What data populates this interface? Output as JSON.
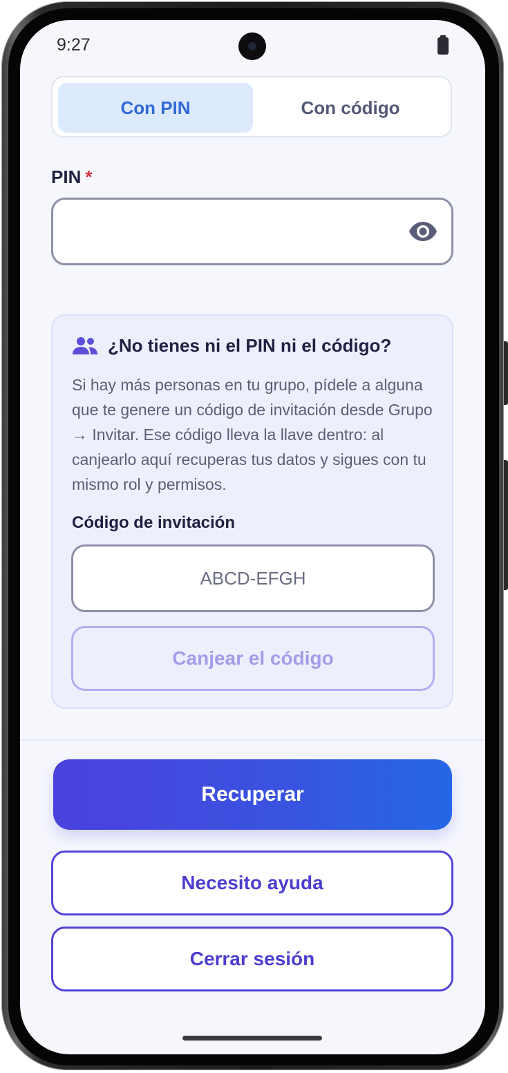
{
  "status_bar": {
    "time": "9:27",
    "icons": [
      "front-camera",
      "battery-icon"
    ]
  },
  "tabs": [
    {
      "label": "Con PIN",
      "selected": true
    },
    {
      "label": "Con código",
      "selected": false
    }
  ],
  "pin_field": {
    "label": "PIN",
    "required_marker": "*",
    "value": "",
    "icon": "eye-icon"
  },
  "help_card": {
    "icon": "people-icon",
    "title": "¿No tienes ni el PIN ni el código?",
    "body": "Si hay más personas en tu grupo, pídele a alguna que te genere un código de invitación desde Grupo → Invitar. Ese código lleva la llave dentro: al canjearlo aquí recuperas tus datos y sigues con tu mismo rol y permisos.",
    "invite_label": "Código de invitación",
    "invite_placeholder": "ABCD-EFGH",
    "redeem_label": "Canjear el código"
  },
  "actions": {
    "primary": "Recuperar",
    "help": "Necesito ayuda",
    "logout": "Cerrar sesión"
  },
  "colors": {
    "primary_gradient_start": "#4b41dd",
    "primary_gradient_end": "#2567e6",
    "accent": "#4c3ecf",
    "tab_active_bg": "#dde9fd",
    "tab_active_text": "#2f6ad8",
    "required": "#d1333f",
    "screen_bg": "#f6f7fd",
    "card_bg": "#eeeffd"
  }
}
